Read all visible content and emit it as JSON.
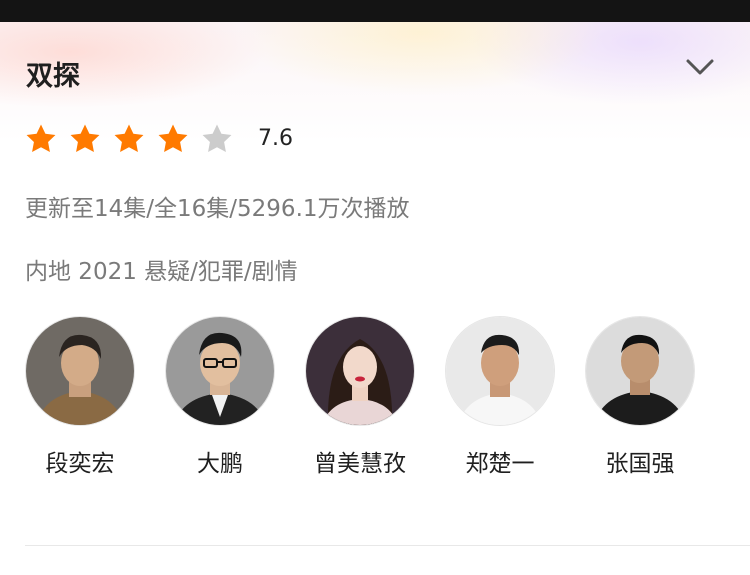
{
  "show": {
    "title": "双探",
    "rating": "7.6",
    "rating_stars": 4,
    "rating_stars_max": 5,
    "episodes_views": "更新至14集/全16集/5296.1万次播放",
    "region_year_genres": "内地 2021 悬疑/犯罪/剧情"
  },
  "colors": {
    "star_filled": "#ff7a00",
    "star_empty": "#cccccc",
    "meta_text": "#7a7a7a"
  },
  "icons": {
    "expand": "chevron-down-icon",
    "star": "star-icon"
  },
  "cast": [
    {
      "name": "段奕宏"
    },
    {
      "name": "大鹏"
    },
    {
      "name": "曾美慧孜"
    },
    {
      "name": "郑楚一"
    },
    {
      "name": "张国强"
    }
  ]
}
